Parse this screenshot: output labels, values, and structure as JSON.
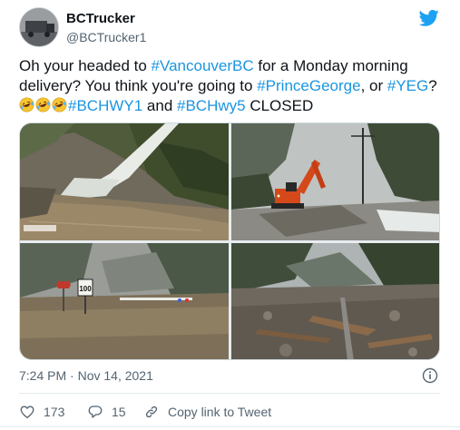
{
  "author": {
    "name": "BCTrucker",
    "handle": "@BCTrucker1"
  },
  "tweet": {
    "part1": "Oh your headed to ",
    "tag1": "#VancouverBC",
    "part2": " for a Monday morning delivery? You think you're going to ",
    "tag2": "#PrinceGeorge",
    "part3": ", or ",
    "tag3": "#YEG",
    "part4": "? ",
    "emoji_name": "rolling-on-the-floor-laughing",
    "tag4": "#BCHWY1",
    "part5": " and ",
    "tag5": "#BCHwy5",
    "part6": " CLOSED"
  },
  "media": {
    "photo_count": 4,
    "photo_1_subject": "waterfall-over-flooded-highway",
    "photo_2_subject": "excavator-on-mudslide",
    "photo_3_subject": "flooded-road-speed-sign",
    "photo_3_sign_text": "100",
    "photo_4_subject": "debris-covered-road"
  },
  "meta": {
    "timestamp": "7:24 PM · Nov 14, 2021"
  },
  "actions": {
    "likes": "173",
    "replies": "15",
    "copy_link": "Copy link to Tweet"
  },
  "colors": {
    "brand": "#1da1f2",
    "hashtag": "#1b95e0",
    "muted": "#536471",
    "text": "#0f1419"
  }
}
